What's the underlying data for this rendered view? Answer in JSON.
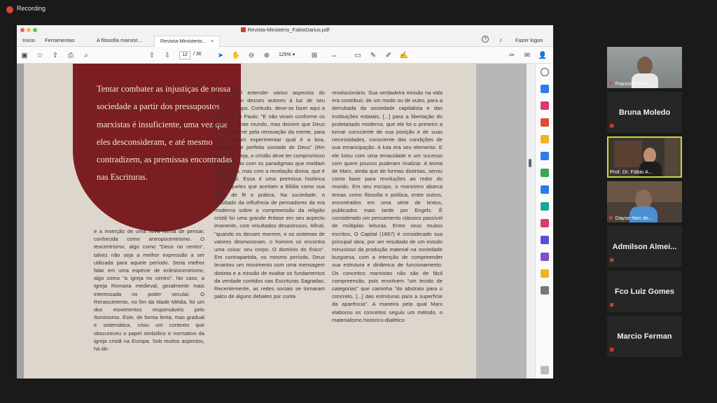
{
  "recording": {
    "label": "Recording"
  },
  "window": {
    "title": "Revista-Ministerio_FabioDarius.pdf"
  },
  "tabs": [
    {
      "label": "Início"
    },
    {
      "label": "Ferramentas"
    },
    {
      "label": "A filosofia marxist..."
    },
    {
      "label": "Revista-Ministerio..."
    }
  ],
  "account": {
    "login_label": "Fazer logon"
  },
  "toolbar": {
    "page_current": "12",
    "page_total": "/ 36",
    "zoom": "125%"
  },
  "doc": {
    "quote": "Tentar combater as injustiças de nossa sociedade a partir dos pressupostos marxistas é insuficiente, uma vez que eles desconsideram, e até mesmo contradizem, as premissas encontradas nas Escrituras.",
    "col1": "e a inserção de uma nova forma de pensar, conhecida como antropocentrismo. O teocentrismo, algo como \"Deus no centro\", talvez não seja a melhor expressão a ser utilizada para aquele período. Seria melhor falar em uma espécie de eclesiocentrismo, algo como \"a igreja no centro\". No caso, a Igreja Romana medieval, geralmente mais interessada no poder secular. O Renascimento, no fim da Idade Média, foi um dos movimentos responsáveis pelo Iluminismo. Este, de forma lenta, mas gradual e sistemática, criou um contexto que obscureceu o papel simbólico e normativo da igreja cristã na Europa. Sob muitos aspectos, há ób-",
    "col2": "É possível entender vários aspectos do pensamento desses autores à luz de seu próprio tempo. Contudo, deve-se fazer aqui a ressalva de Paulo: \"E não vivam conforme os padrões deste mundo, mas deixem que Deus os transforme pela renovação da mente, para que possam experimentar qual é a boa, agradável e perfeita vontade de Deus\" (Rm 12:2). Ou seja, o cristão deve ter compromisso primário não com os paradigmas que moldam seu tempo, mas com a revelação divina, que é atemporal. Essa é uma premissa histórica para aqueles que aceitam a Bíblia como sua regra de fé e prática. Na sociedade, o resultado da influência de pensadores da era moderna sobre a compreensão da religião cristã foi uma grande ênfase em seu aspecto imanente, com resultados desastrosos. Afinal, \"quando os deuses morrem, e os sistemas de valores desmoronam, o homem só encontra uma coisa: seu corpo. O domínio do físico\". Em contrapartida, no mesmo período, Deus levantou um movimento com uma mensagem distinta e a missão de exaltar os fundamentos da verdade contidos nas Escrituras Sagradas. Recentemente, as redes sociais se tornaram palco de alguns debates por conta",
    "col3": "revolucionário. Sua verdadeira missão na vida era contribuir, de um modo ou de outro, para a derrubada da sociedade capitalista e das instituições estatais, [...] para a libertação do proletariado moderno, que ele foi o primeiro a tornar consciente de sua posição e de suas necessidades, consciente das condições de sua emancipação. A luta era seu elemento. E ele lutou com uma tenacidade e um sucesso com quem poucos puderam rivalizar. A teoria de Marx, ainda que de formas distintas, serviu como base para revoluções ao redor do mundo. Em seu escopo, o marxismo abarca temas como filosofia e política, entre outros, encontrados em uma série de textos, publicados mais tarde por Engels. É considerado um pensamento clássico passível de múltiplas leituras. Entre seus muitos escritos, O Capital (1867) é considerado sua principal obra, por ser resultado de um estudo minucioso da produção material na sociedade burguesa, com a intenção de compreender sua estrutura e dinâmica de funcionamento. Os conceitos marxistas não são de fácil compreensão, pois envolvem \"um tecido de categorias\" que caminha \"do abstrato para o concreto, [...] das estruturas para a superfície da aparência\". A maneira pela qual Marx elaborou os conceitos seguiu um método, o materialismo histórico-dialético"
  },
  "participants": [
    {
      "name": "Francislê Neri ...",
      "has_video": true
    },
    {
      "name": "Bruna Moledo",
      "has_video": false
    },
    {
      "name": "Prof. Dr. Fábio A...",
      "has_video": true,
      "active_speaker": true
    },
    {
      "name": "Dayse Neri de...",
      "has_video": true
    },
    {
      "name": "Admilson Almei...",
      "has_video": false
    },
    {
      "name": "Fco Luiz Gomes",
      "has_video": false
    },
    {
      "name": "Marcio Ferman",
      "has_video": false
    }
  ],
  "colors": {
    "accent_red": "#7a1e22",
    "highlight": "#f2d56b",
    "speaker_border": "#c8d93a"
  }
}
